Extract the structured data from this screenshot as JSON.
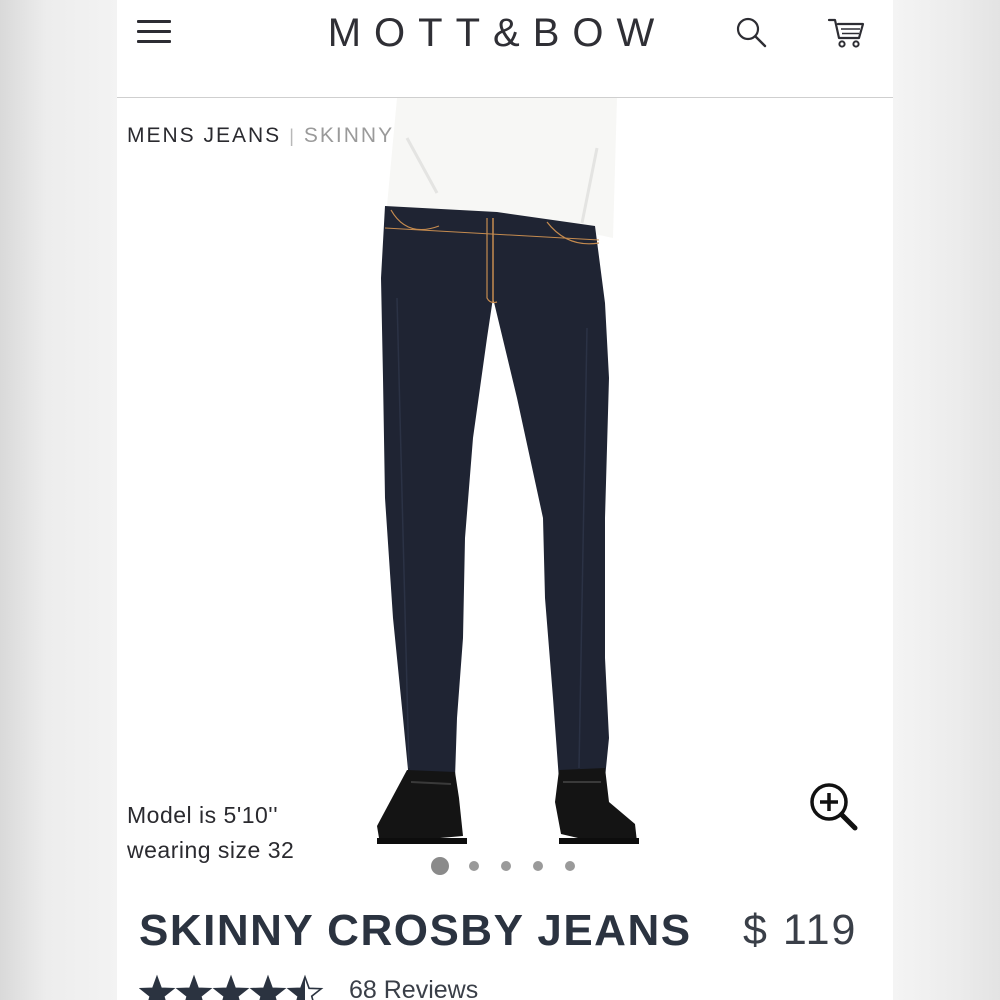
{
  "header": {
    "brand": "MOTT&BOW",
    "icons": [
      "menu-icon",
      "search-icon",
      "cart-icon"
    ]
  },
  "breadcrumb": {
    "parent": "MENS JEANS",
    "separator": "|",
    "current": "SKINNY"
  },
  "gallery": {
    "model_note_line1": "Model is 5'10''",
    "model_note_line2": "wearing size 32",
    "slide_count": 5,
    "active_slide": 1,
    "zoom_icon": "zoom-in-icon"
  },
  "product": {
    "name": "SKINNY CROSBY JEANS",
    "price": "$ 119",
    "rating": 4.5,
    "rating_max": 5,
    "reviews": "68 Reviews"
  },
  "colors": {
    "text": "#2b3340",
    "denim": "#1f2433",
    "shirt": "#f7f7f5"
  }
}
